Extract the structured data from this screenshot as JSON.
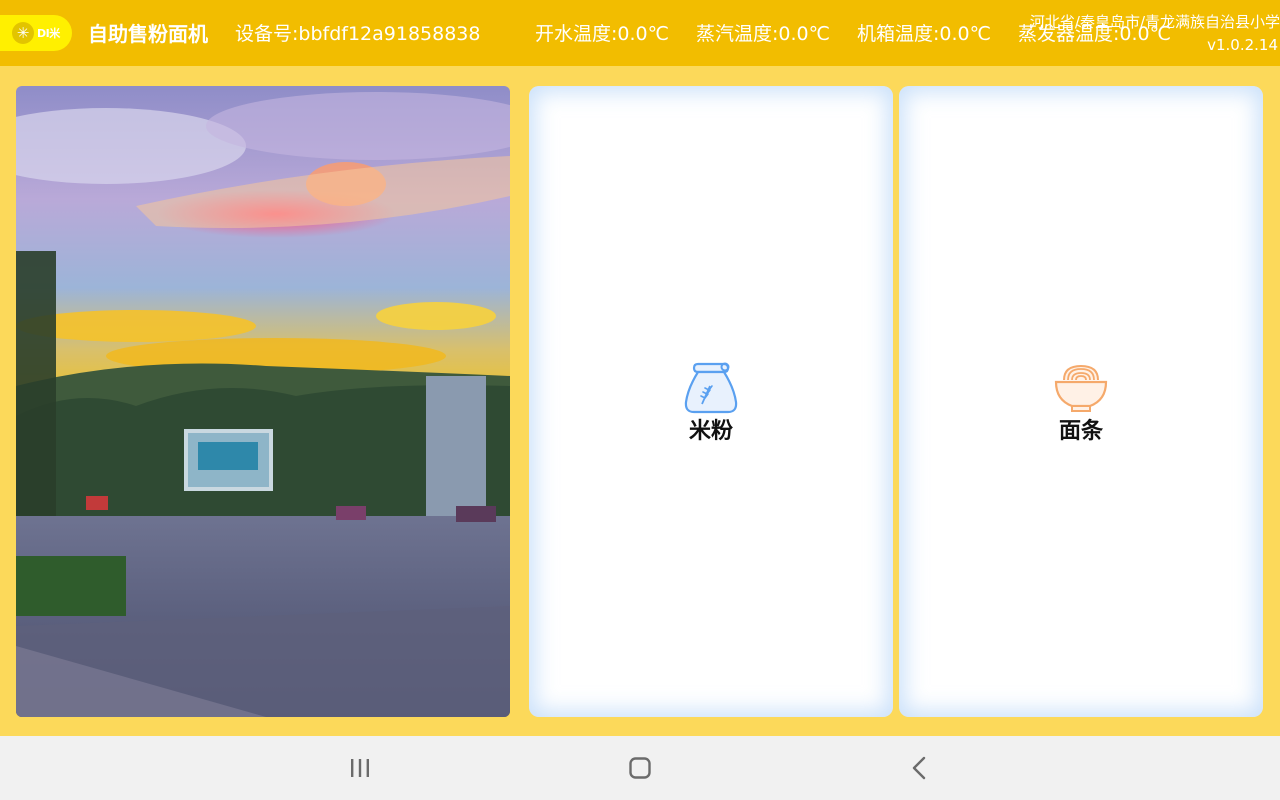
{
  "header": {
    "logo_text": "DI米",
    "app_title": "自助售粉面机",
    "device_id": "设备号:bbfdf12a91858838",
    "temperatures": {
      "boiling_water": "开水温度:0.0℃",
      "steam": "蒸汽温度:0.0℃",
      "cabinet": "机箱温度:0.0℃",
      "evaporator": "蒸发器温度:0.0℃"
    },
    "location": "河北省/秦皇岛市/青龙满族自治县小学",
    "version": "v1.0.2.14"
  },
  "banner": {
    "icon": "sunset-photo"
  },
  "categories": [
    {
      "label": "米粉",
      "icon": "rice-flour-bag-icon",
      "color": "#5AA0F0"
    },
    {
      "label": "面条",
      "icon": "noodle-bowl-icon",
      "color": "#F5A96B"
    }
  ],
  "navbar": {
    "recent_icon": "recent-apps-icon",
    "home_icon": "home-icon",
    "back_icon": "back-icon"
  },
  "colors": {
    "header_bg": "#F2BD00",
    "page_bg": "#FCD95A",
    "logo_bg": "#FFF000"
  }
}
